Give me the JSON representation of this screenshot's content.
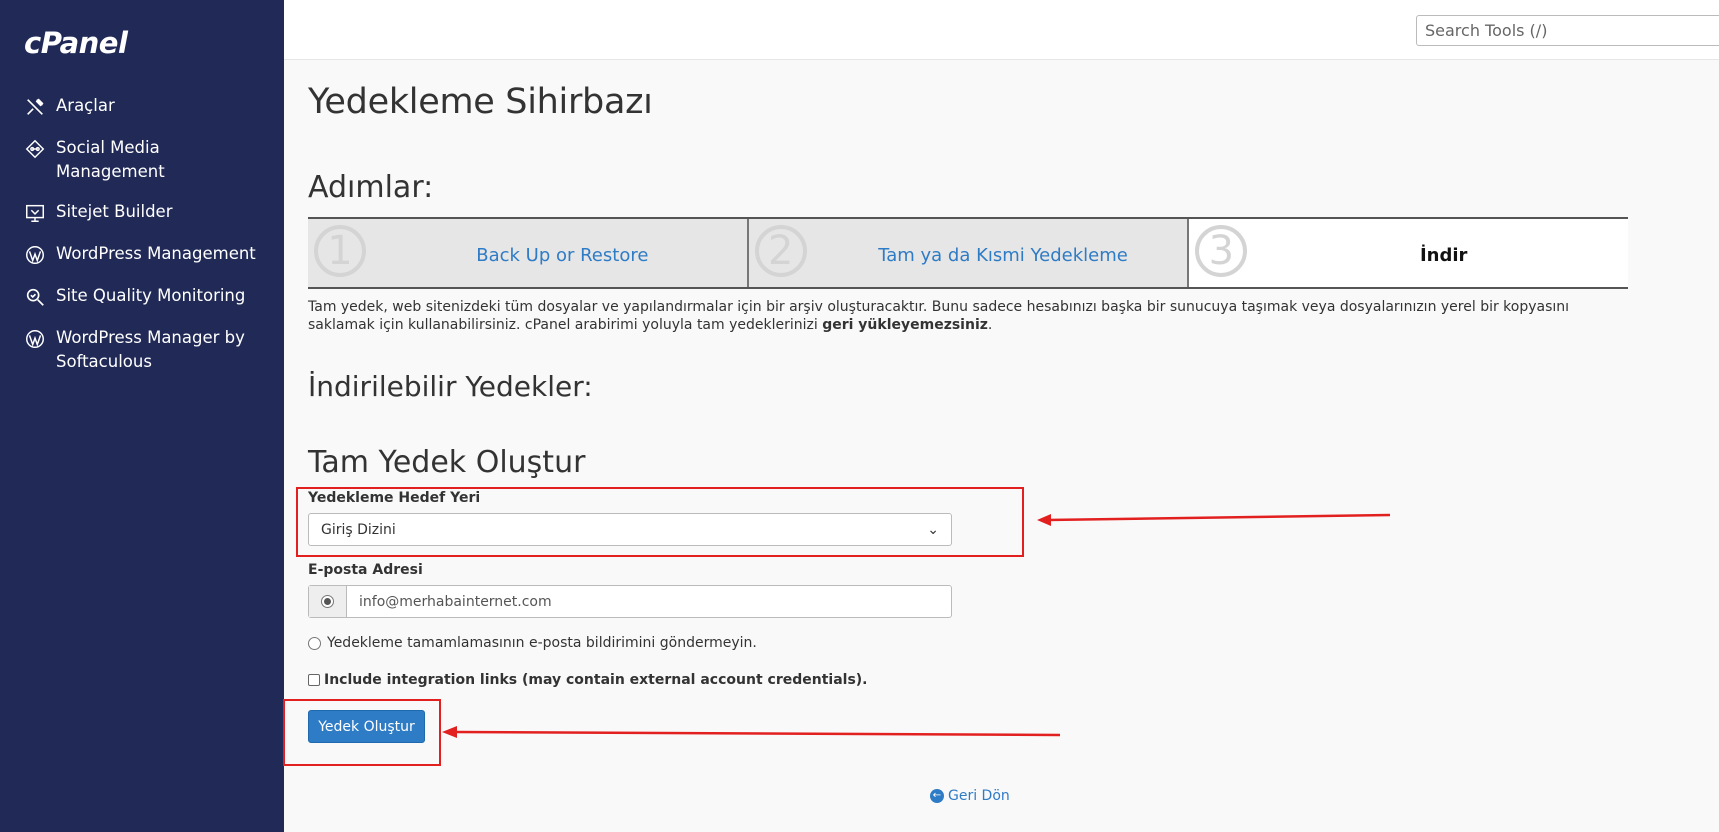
{
  "brand": {
    "logo_text": "cPanel"
  },
  "sidebar": {
    "items": [
      {
        "label": "Araçlar",
        "icon": "tools-icon"
      },
      {
        "label": "Social Media Management",
        "icon": "social-media-icon"
      },
      {
        "label": "Sitejet Builder",
        "icon": "sitejet-icon"
      },
      {
        "label": "WordPress Management",
        "icon": "wordpress-icon"
      },
      {
        "label": "Site Quality Monitoring",
        "icon": "magnifier-icon"
      },
      {
        "label": "WordPress Manager by Softaculous",
        "icon": "wordpress-icon"
      }
    ]
  },
  "search": {
    "placeholder": "Search Tools (/)"
  },
  "page": {
    "title": "Yedekleme Sihirbazı",
    "steps_heading": "Adımlar:",
    "steps": [
      {
        "number": "1",
        "label": "Back Up or Restore"
      },
      {
        "number": "2",
        "label": "Tam ya da Kısmi Yedekleme"
      },
      {
        "number": "3",
        "label": "İndir"
      }
    ],
    "description_main": "Tam yedek, web sitenizdeki tüm dosyalar ve yapılandırmalar için bir arşiv oluşturacaktır. Bunu sadece hesabınızı başka bir sunucuya taşımak veya dosyalarınızın yerel bir kopyasını saklamak için kullanabilirsiniz. cPanel arabirimi yoluyla tam yedeklerinizi ",
    "description_bold": "geri yükleyemezsiniz",
    "description_end": ".",
    "downloadable_heading": "İndirilebilir Yedekler:",
    "full_backup_heading": "Tam Yedek Oluştur",
    "destination_label": "Yedekleme Hedef Yeri",
    "destination_value": "Giriş Dizini",
    "email_label": "E-posta Adresi",
    "email_value": "info@merhabainternet.com",
    "no_email_option": "Yedekleme tamamlamasının e-posta bildirimini göndermeyin.",
    "integration_option": "Include integration links (may contain external account credentials).",
    "generate_button": "Yedek Oluştur",
    "back_link": "Geri Dön"
  },
  "annotations": {
    "highlight_color": "#e32020"
  }
}
